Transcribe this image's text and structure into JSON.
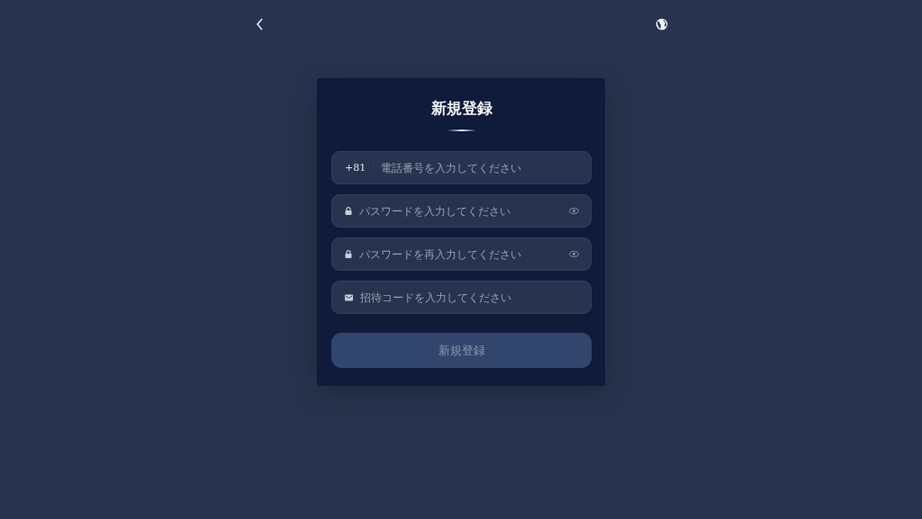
{
  "title": "新規登録",
  "fields": [
    {
      "kind": "phone",
      "prefix": "+81",
      "placeholder": "電話番号を入力してください"
    },
    {
      "kind": "password",
      "placeholder": "パスワードを入力してください"
    },
    {
      "kind": "password",
      "placeholder": "パスワードを再入力してください"
    },
    {
      "kind": "code",
      "placeholder": "招待コードを入力してください"
    }
  ],
  "submit": {
    "label": "新規登録",
    "disabled": true
  }
}
